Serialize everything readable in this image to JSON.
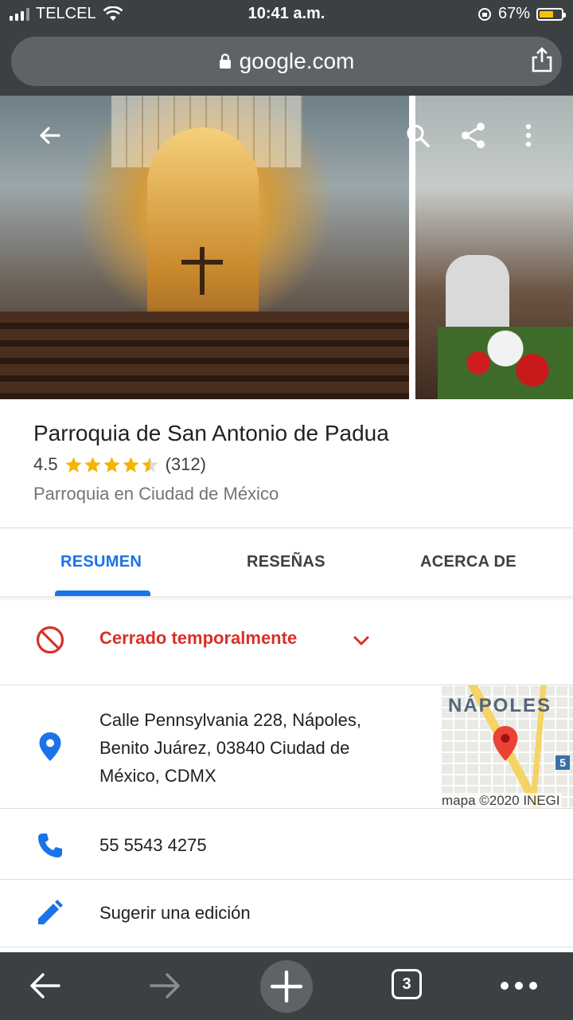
{
  "status_bar": {
    "carrier": "TELCEL",
    "time": "10:41 a.m.",
    "battery_percent": "67%",
    "battery_level": 0.67
  },
  "browser": {
    "url": "google.com"
  },
  "place": {
    "name": "Parroquia de San Antonio de Padua",
    "rating": "4.5",
    "rating_value": 4.5,
    "reviews_count": "(312)",
    "category": "Parroquia en Ciudad de México"
  },
  "tabs": [
    {
      "label": "RESUMEN",
      "active": true
    },
    {
      "label": "RESEÑAS",
      "active": false
    },
    {
      "label": "ACERCA DE",
      "active": false
    }
  ],
  "status": {
    "text": "Cerrado temporalmente"
  },
  "address": {
    "line1": "Calle Pennsylvania 228, Nápoles,",
    "line2": "Benito Juárez, 03840 Ciudad de",
    "line3": "México, CDMX"
  },
  "map": {
    "label": "NÁPOLES",
    "road_badge": "5",
    "copyright": "mapa ©2020 INEGI"
  },
  "phone": "55 5543 4275",
  "suggest_edit": "Sugerir una edición",
  "toolbar": {
    "tab_count": "3"
  },
  "colors": {
    "accent": "#1a73e8",
    "closed_red": "#d93025",
    "star": "#f4b400",
    "chrome_dark": "#3c4043"
  },
  "icons": [
    "back-arrow-icon",
    "search-icon",
    "share-icon",
    "more-vert-icon",
    "lock-icon",
    "share-up-icon",
    "no-entry-icon",
    "chevron-down-icon",
    "location-pin-icon",
    "phone-icon",
    "pencil-icon",
    "forward-arrow-icon",
    "plus-icon",
    "tabs-icon",
    "more-horiz-icon"
  ]
}
